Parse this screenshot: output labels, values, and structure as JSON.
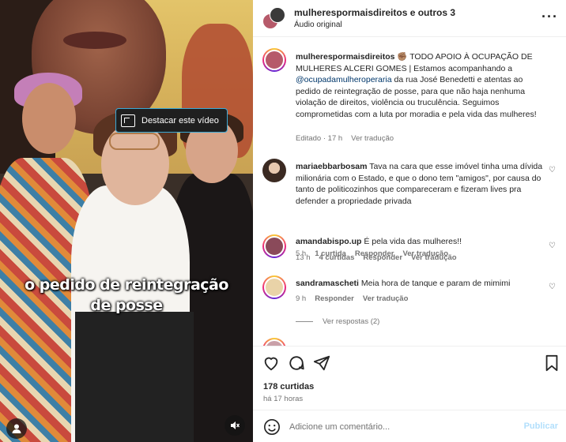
{
  "video": {
    "tooltip": "Destacar este vídeo",
    "caption_line1": "o pedido de reintegração",
    "caption_line2": "de posse",
    "user_icon": "user-icon",
    "mute_icon": "muted-speaker-icon"
  },
  "header": {
    "title": "mulherespormaisdireitos e outros 3",
    "subtitle": "Áudio original",
    "more_icon": "more-horizontal-icon"
  },
  "post": {
    "username": "mulherespormaisdireitos",
    "text_pre": "✊🏽 TODO APOIO À OCUPAÇÃO DE MULHERES ALCERI GOMES | Estamos acompanhando a ",
    "mention": "@ocupadamulheroperaria",
    "text_post": " da rua José Benedetti e atentas ao pedido de reintegração de posse, para que não haja nenhuma violação de direitos, violência ou truculência. Seguimos comprometidas com a luta por moradia e pela vida das mulheres!",
    "meta_edited": "Editado · 17 h",
    "meta_translate": "Ver tradução"
  },
  "comments": [
    {
      "username": "mariaebbarbosam",
      "text": "Tava na cara que esse imóvel tinha uma dívida milionária com o Estado, e que o dono tem \"amigos\", por causa do tanto de politicozinhos que compareceram e fizeram lives pra defender a propriedade privada",
      "time": "5 h",
      "likes": "1 curtida",
      "reply": "Responder",
      "translate": "Ver tradução"
    },
    {
      "username": "amandabispo.up",
      "text": "É pela vida das mulheres!!",
      "time": "13 h",
      "likes": "4 curtidas",
      "reply": "Responder",
      "translate": "Ver tradução"
    },
    {
      "username": "sandramascheti",
      "text": "Meia hora de tanque e param de mimimi",
      "time": "9 h",
      "reply": "Responder",
      "translate": "Ver tradução",
      "view_replies": "Ver respostas (2)"
    }
  ],
  "actions": {
    "like_icon": "heart-icon",
    "comment_icon": "comment-icon",
    "share_icon": "share-icon",
    "save_icon": "bookmark-icon",
    "likes_count": "178 curtidas",
    "posted_ago": "há 17 horas"
  },
  "add_comment": {
    "emoji_icon": "emoji-icon",
    "placeholder": "Adicione um comentário...",
    "publish": "Publicar"
  },
  "colors": {
    "link": "#00376b",
    "muted": "#737373",
    "publish_disabled": "#b2dffc",
    "tooltip_border": "#3aa9d6"
  }
}
